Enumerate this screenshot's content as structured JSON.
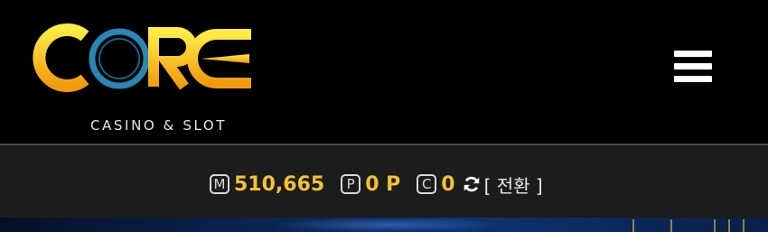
{
  "brand": {
    "logo_text": "CORE",
    "tagline": "CASINO & SLOT",
    "colors": {
      "gold_light": "#ffe640",
      "gold_dark": "#f29a0c",
      "ring": "#2a86b4"
    }
  },
  "header": {
    "menu_icon": "hamburger-menu-icon"
  },
  "balances": {
    "money_badge": "M",
    "money_value": "510,665",
    "point_badge": "P",
    "point_value": "0 P",
    "coin_badge": "C",
    "coin_value": "0",
    "refresh_icon": "refresh-icon",
    "switch_label": "[ 전환 ]",
    "value_color": "#f2c230"
  }
}
